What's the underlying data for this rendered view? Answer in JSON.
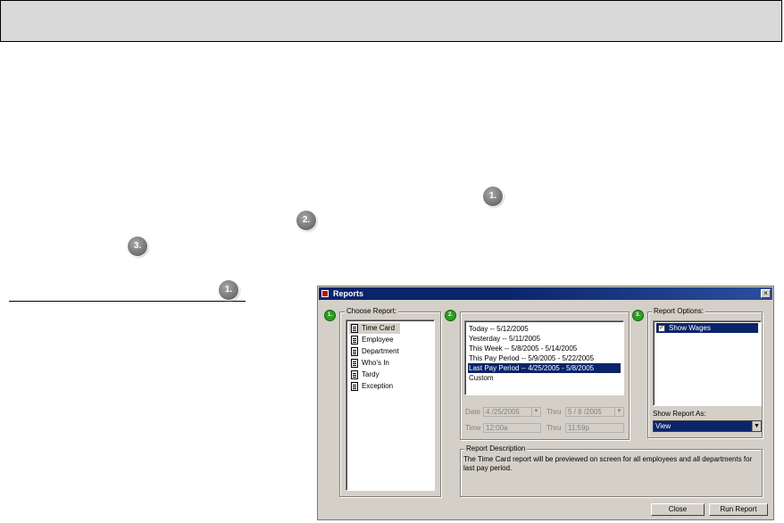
{
  "page": {
    "badges": [
      "1.",
      "2.",
      "3."
    ],
    "under_badge": "1."
  },
  "dialog": {
    "title": "Reports",
    "close_glyph": "×",
    "step1_badge": "1.",
    "step2_badge": "2.",
    "step3_badge": "3.",
    "choose_report": {
      "label": "Choose Report:",
      "items": [
        "Time Card",
        "Employee",
        "Department",
        "Who's In",
        "Tardy",
        "Exception"
      ],
      "selected_index": 0
    },
    "date_range": {
      "items": [
        "Today -- 5/12/2005",
        "Yesterday -- 5/11/2005",
        "This Week -- 5/8/2005 - 5/14/2005",
        "This Pay Period -- 5/9/2005 - 5/22/2005",
        "Last Pay Period -- 4/25/2005 - 5/8/2005",
        "Custom"
      ],
      "selected_index": 4
    },
    "fields": {
      "date_label": "Date",
      "date_value": "4 /25/2005",
      "thru_label": "Thru",
      "thru_value": "5 / 8 /2005",
      "time_label": "Time",
      "time_value": "12:00a",
      "time_thru_label": "Thru",
      "time_thru_value": "11:59p"
    },
    "report_description": {
      "label": "Report Description",
      "text": "The Time Card report will be previewed on screen for all employees and all departments for last pay period."
    },
    "report_options": {
      "label": "Report Options:",
      "items": [
        {
          "label": "Show Wages",
          "checked": true
        }
      ],
      "show_as_label": "Show Report As:",
      "show_as_value": "View"
    },
    "buttons": {
      "close": "Close",
      "run": "Run Report"
    }
  }
}
